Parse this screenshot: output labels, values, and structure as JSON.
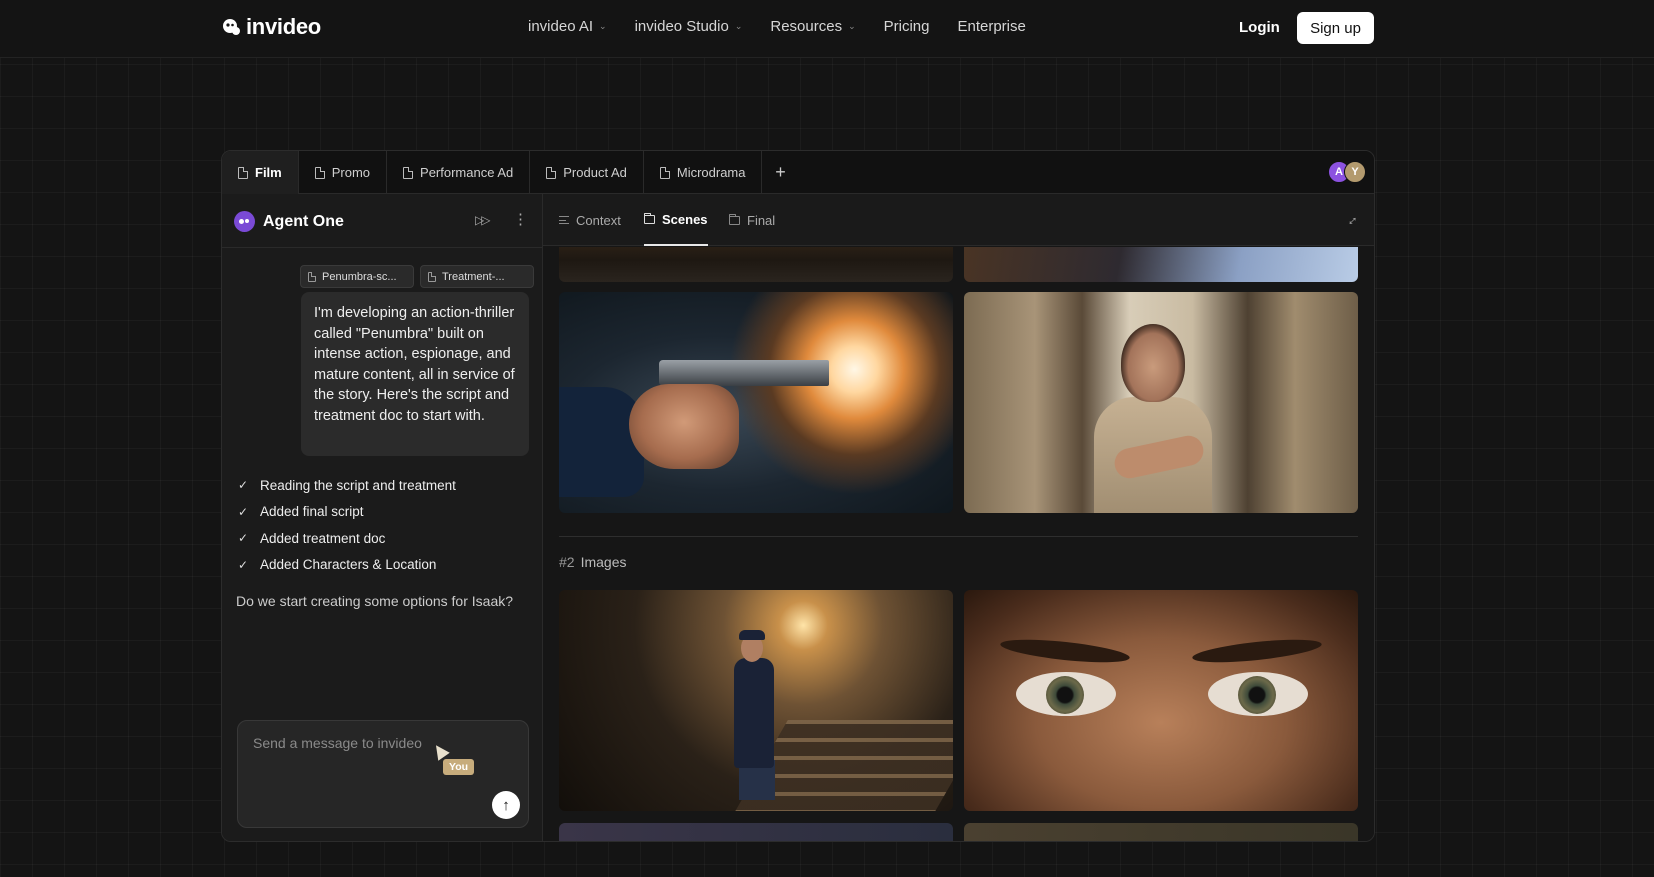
{
  "nav": {
    "brand": "invideo",
    "links": [
      {
        "label": "invideo AI",
        "has_dropdown": true
      },
      {
        "label": "invideo Studio",
        "has_dropdown": true
      },
      {
        "label": "Resources",
        "has_dropdown": true
      },
      {
        "label": "Pricing",
        "has_dropdown": false
      },
      {
        "label": "Enterprise",
        "has_dropdown": false
      }
    ],
    "login": "Login",
    "signup": "Sign up"
  },
  "tabs": [
    {
      "label": "Film",
      "active": true
    },
    {
      "label": "Promo"
    },
    {
      "label": "Performance Ad"
    },
    {
      "label": "Product Ad"
    },
    {
      "label": "Microdrama"
    }
  ],
  "tab_add": "+",
  "avatars": [
    {
      "initial": "A",
      "color": "#8c52e0"
    },
    {
      "initial": "Y",
      "color": "#b39a6e"
    }
  ],
  "agent": {
    "name": "Agent One",
    "attachments": [
      "Penumbra-sc...",
      "Treatment-..."
    ],
    "user_message": "I'm developing an action-thriller called \"Penumbra\" built on intense action, espionage, and mature content, all in service of the story. Here's the script and treatment doc to start with.",
    "steps": [
      "Reading the script and treatment",
      "Added final script",
      "Added treatment doc",
      "Added Characters & Location"
    ],
    "question": "Do we start creating some options for Isaak?",
    "composer_placeholder": "Send a message to invideo",
    "cursor_tag": "You"
  },
  "subtabs": [
    {
      "label": "Context",
      "icon": "context-icon"
    },
    {
      "label": "Scenes",
      "icon": "folder-icon",
      "active": true
    },
    {
      "label": "Final",
      "icon": "folder-icon"
    }
  ],
  "scenes": {
    "section_number": "#2",
    "section_label": "Images"
  }
}
